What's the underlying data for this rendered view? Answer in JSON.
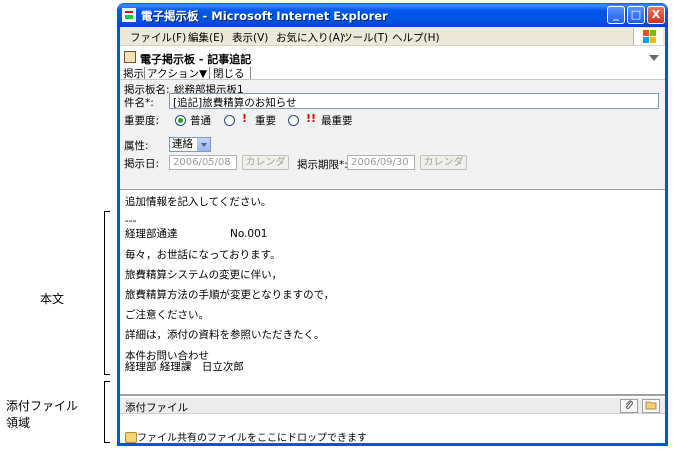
{
  "annotations": {
    "body_label": "本文",
    "attach_label_line1": "添付ファイル",
    "attach_label_line2": "領域"
  },
  "window": {
    "title": "電子掲示板 - Microsoft Internet Explorer",
    "buttons": {
      "minimize": "_",
      "maximize": "□",
      "close": "X"
    }
  },
  "menu": {
    "items": [
      "ファイル(F)",
      "編集(E)",
      "表示(V)",
      "お気に入り(A)",
      "ツール(T)",
      "ヘルプ(H)"
    ]
  },
  "page_header": {
    "title": "電子掲示板 - 記事追記",
    "toolbar": [
      "掲示",
      "アクション▼",
      "閉じる"
    ]
  },
  "form": {
    "board_label": "掲示板名:",
    "board_value": "総務部掲示板1",
    "subject_label": "件名*:",
    "subject_value": "[追記]旅費精算のお知らせ",
    "importance_label": "重要度:",
    "importance_options": [
      "普通",
      "重要",
      "最重要"
    ],
    "importance_selected": "普通",
    "attribute_label": "属性:",
    "attribute_value": "連絡",
    "post_date_label": "掲示日:",
    "post_date_value": "2006/05/08",
    "calendar_label": "カレンダ",
    "deadline_label": "掲示期限*:",
    "deadline_value": "2006/09/30"
  },
  "body": {
    "lines": [
      "追加情報を記入してください。",
      "---",
      "経理部通達　　　　　No.001",
      "毎々，お世話になっております。",
      "旅費精算システムの変更に伴い，",
      "旅費精算方法の手順が変更となりますので，",
      "ご注意ください。",
      "詳細は，添付の資料を参照いただきたく。",
      "本件お問い合わせ",
      "経理部 経理課　日立次郎"
    ]
  },
  "attachment": {
    "header": "添付ファイル",
    "drop_hint": "ファイル共有のファイルをここにドロップできます"
  },
  "colors": {
    "title_bar": "#0054e3",
    "importance_mark": "#e00000",
    "radio_selected": "#21a121"
  },
  "icons": {
    "window": "ie-page-icon",
    "attach": "paperclip-icon",
    "folder": "folder-icon",
    "dropdown": "chevron-down-icon"
  }
}
